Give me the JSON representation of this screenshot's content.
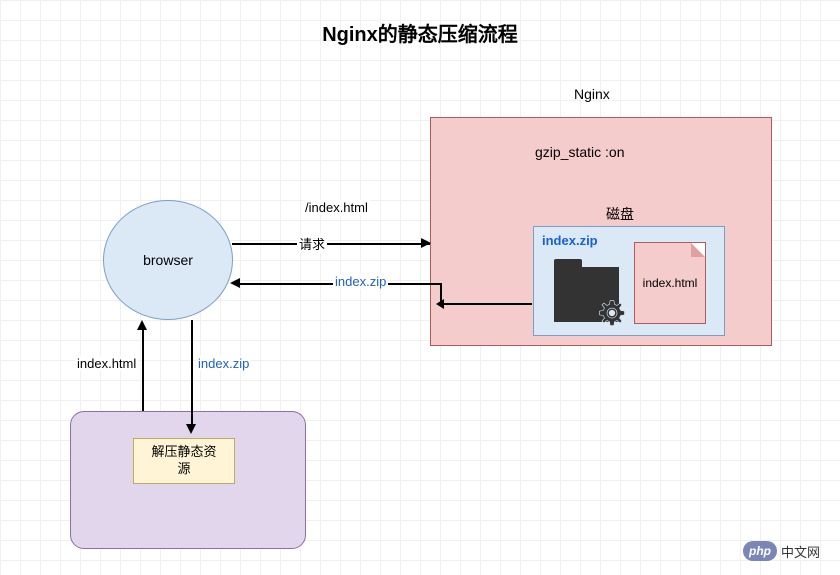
{
  "title": "Nginx的静态压缩流程",
  "nginx": {
    "label": "Nginx",
    "gzip": "gzip_static :on",
    "disk_label": "磁盘",
    "zip_name": "index.zip",
    "file_name": "index.html"
  },
  "browser": {
    "label": "browser"
  },
  "arrows": {
    "request_path": "/index.html",
    "request_label": "请求",
    "response_zip": "index.zip",
    "down_zip": "index.zip",
    "up_html": "index.html"
  },
  "decompress": {
    "label": "解压静态资\n源"
  },
  "watermark": {
    "badge": "php",
    "text": "中文网"
  }
}
